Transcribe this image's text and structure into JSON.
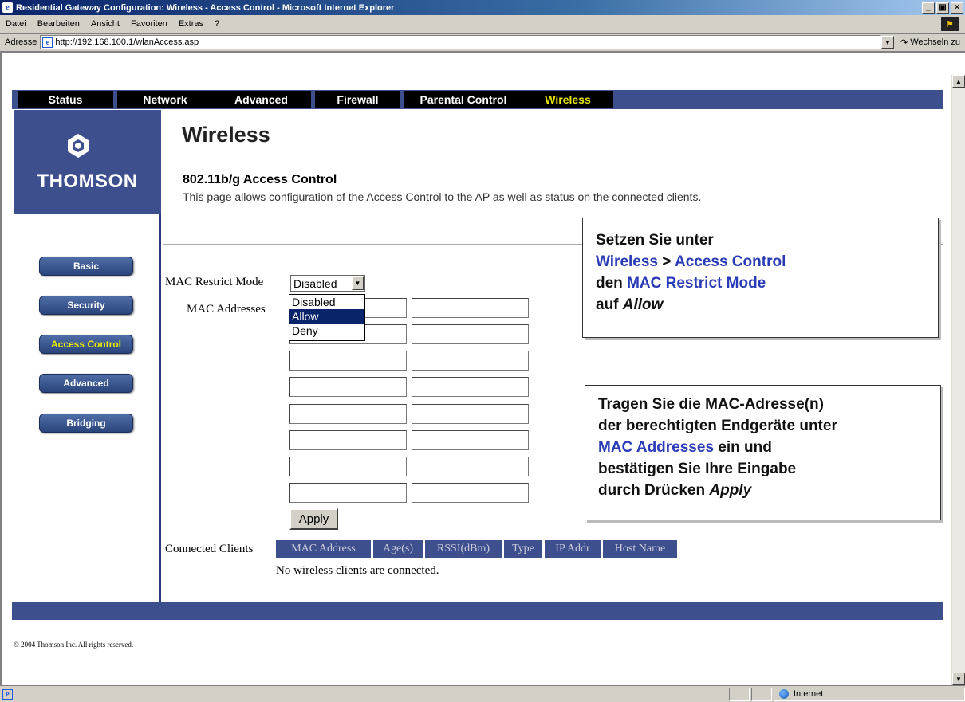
{
  "window": {
    "title": "Residential Gateway Configuration: Wireless - Access Control - Microsoft Internet Explorer",
    "controls": [
      "_",
      "ÿ",
      "×"
    ]
  },
  "menu": [
    "Datei",
    "Bearbeiten",
    "Ansicht",
    "Favoriten",
    "Extras",
    "?"
  ],
  "address": {
    "label": "Adresse",
    "url": "http://192.168.100.1/wlanAccess.asp",
    "go_label": "Wechseln zu"
  },
  "statusbar": {
    "zone": "Internet"
  },
  "topnav": {
    "tabs": [
      {
        "label": "Status",
        "active": false
      },
      {
        "label": "Network",
        "active": false
      },
      {
        "label": "Advanced",
        "active": false
      },
      {
        "label": "Firewall",
        "active": false
      },
      {
        "label": "Parental Control",
        "active": false
      },
      {
        "label": "Wireless",
        "active": true
      }
    ]
  },
  "brand": {
    "name": "THOMSON",
    "icon": "thomson-logo-icon"
  },
  "sidebar": {
    "items": [
      {
        "label": "Basic",
        "active": false
      },
      {
        "label": "Security",
        "active": false
      },
      {
        "label": "Access Control",
        "active": true
      },
      {
        "label": "Advanced",
        "active": false
      },
      {
        "label": "Bridging",
        "active": false
      }
    ]
  },
  "page": {
    "title": "Wireless",
    "subtitle": "802.11b/g Access Control",
    "description": "This page allows configuration of the Access Control to the AP as well as status on the connected clients."
  },
  "form": {
    "mac_mode_label": "MAC Restrict Mode",
    "mac_mode_value": "Disabled",
    "mac_mode_options": [
      "Disabled",
      "Allow",
      "Deny"
    ],
    "mac_mode_highlighted": "Allow",
    "mac_addresses_label": "MAC Addresses",
    "mac_address_values": [
      "",
      "",
      "",
      "",
      "",
      "",
      "",
      "",
      "",
      "",
      "",
      "",
      "",
      "",
      "",
      ""
    ],
    "apply_label": "Apply"
  },
  "clients": {
    "label": "Connected Clients",
    "columns": [
      "MAC Address",
      "Age(s)",
      "RSSI(dBm)",
      "Type",
      "IP Addr",
      "Host Name"
    ],
    "empty_message": "No wireless clients are connected."
  },
  "footer": {
    "copyright": "© 2004 Thomson Inc.   All rights reserved."
  },
  "callouts": {
    "first": {
      "line1": "Setzen Sie unter",
      "kw_wireless": "Wireless",
      "sep": ">",
      "kw_access": "Access Control",
      "line3_pre": "den",
      "kw_mode": "MAC Restrict Mode",
      "line4_pre": "auf",
      "line4_it": "Allow"
    },
    "second": {
      "line1": "Tragen Sie die MAC-Adresse(n)",
      "line2": "der berechtigten Endgeräte unter",
      "kw_addresses": "MAC Addresses",
      "line3_post": "ein und",
      "line4": "bestätigen Sie Ihre Eingabe",
      "line5_pre": "durch Drücken",
      "line5_it": "Apply"
    }
  },
  "colors": {
    "nav_bar": "#3e4f8e",
    "active_tab_text": "#e8e800",
    "callout_keyword": "#2a3bb7"
  }
}
